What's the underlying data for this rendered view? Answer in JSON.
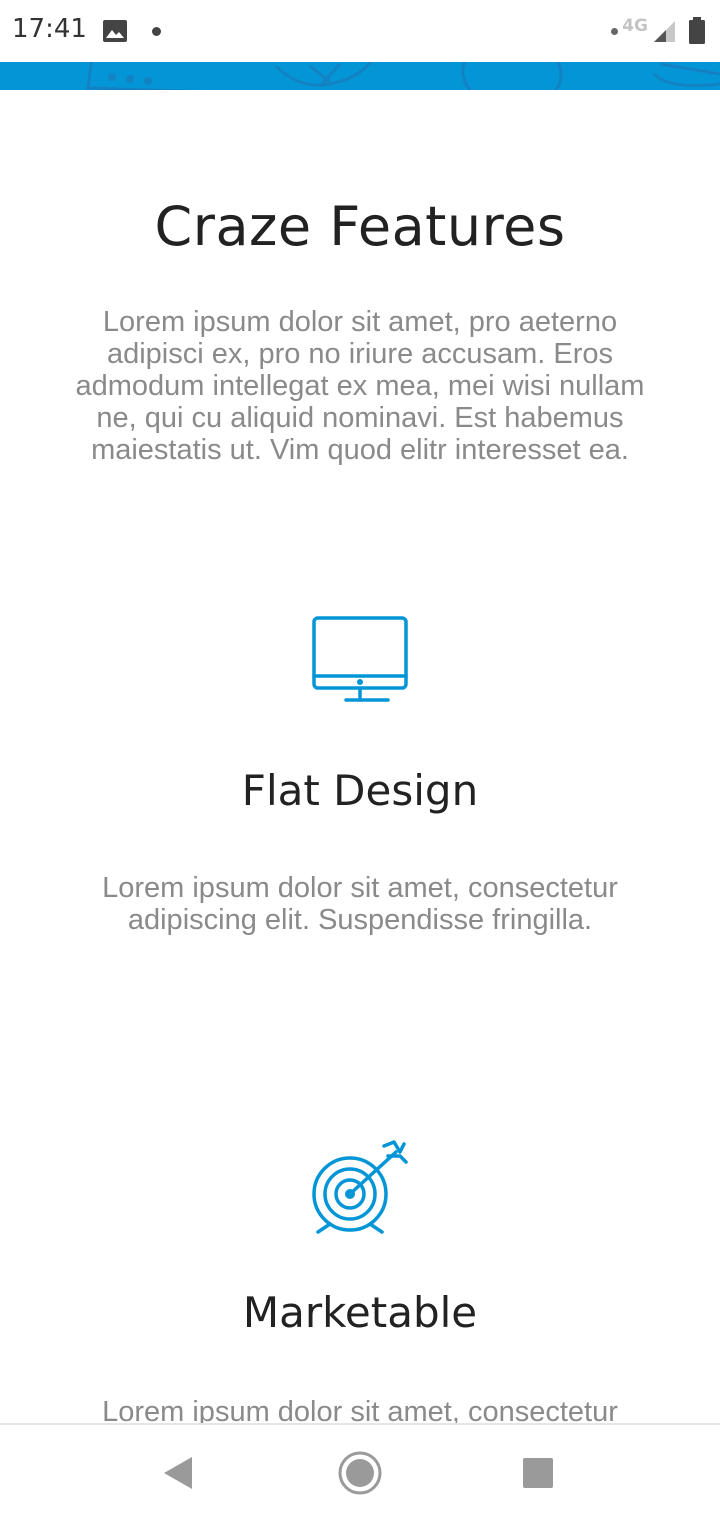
{
  "status_bar": {
    "time": "17:41",
    "network": "4G",
    "icons": [
      "gallery-icon",
      "notification-dot",
      "signal-dot",
      "cell-signal-icon",
      "battery-icon"
    ]
  },
  "colors": {
    "accent": "#0495d6",
    "title_text": "#222222",
    "body_text": "#8a8a8a",
    "nav_icon": "#9a9a9a"
  },
  "section": {
    "title": "Craze Features",
    "description": "Lorem ipsum dolor sit amet, pro aeterno adipisci ex, pro no iriure accusam. Eros admodum intellegat ex mea, mei wisi nullam ne, qui cu aliquid nominavi. Est habemus maiestatis ut. Vim quod elitr interesset ea."
  },
  "features": [
    {
      "icon": "desktop-monitor-icon",
      "title": "Flat Design",
      "description": "Lorem ipsum dolor sit amet, consectetur adipiscing elit. Suspendisse fringilla."
    },
    {
      "icon": "target-arrow-icon",
      "title": "Marketable",
      "description": "Lorem ipsum dolor sit amet, consectetur"
    }
  ],
  "nav_bar": {
    "buttons": [
      "back-icon",
      "home-icon",
      "recents-icon"
    ]
  }
}
